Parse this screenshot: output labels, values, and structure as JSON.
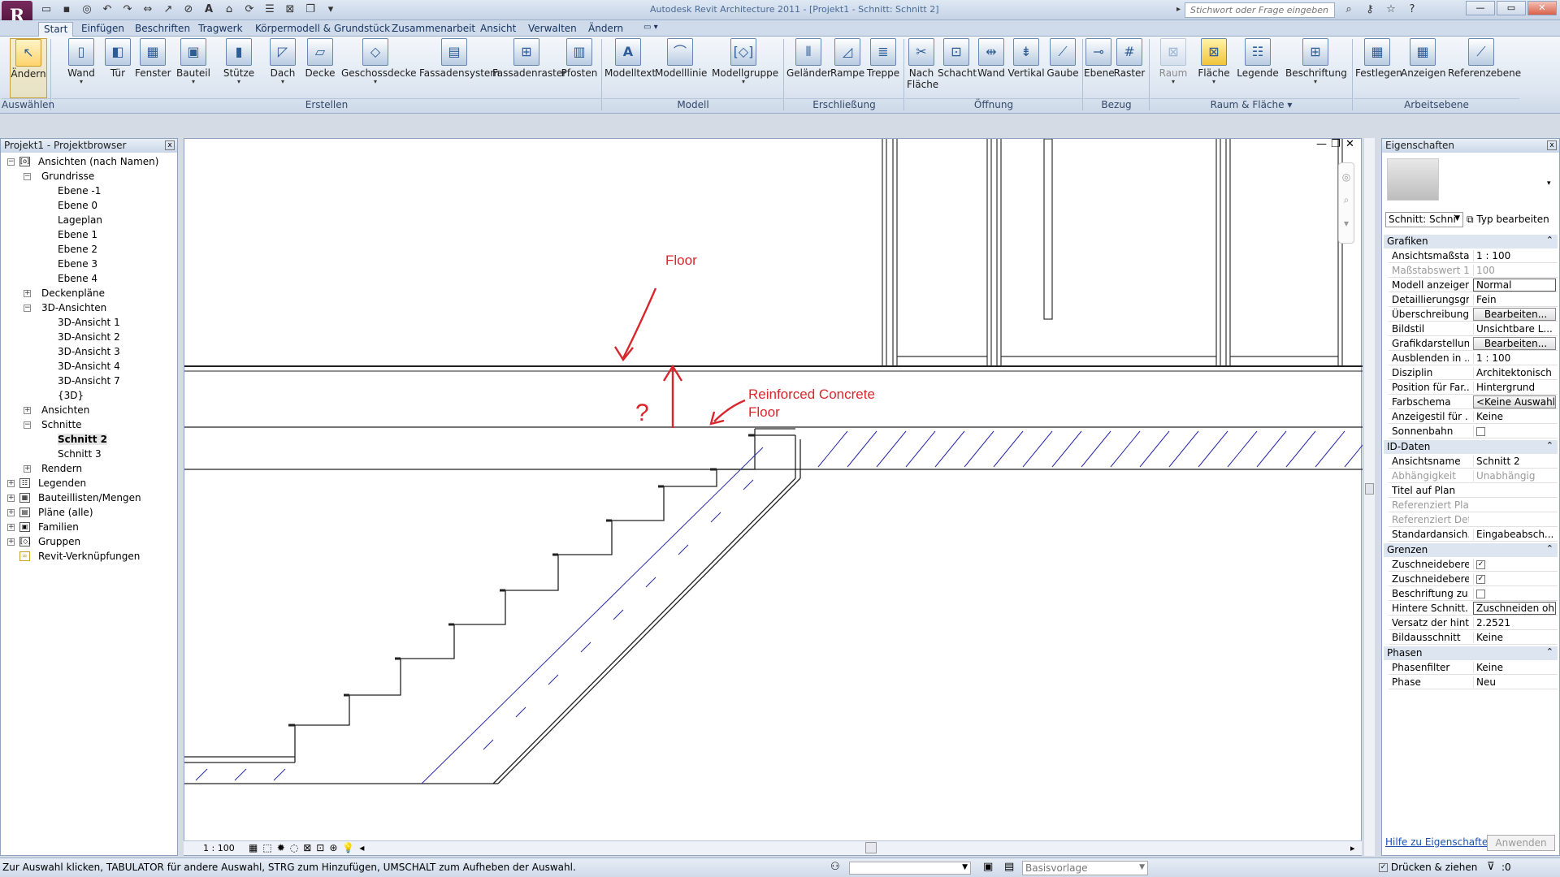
{
  "titlebar": {
    "title": "Autodesk Revit Architecture 2011 - [Projekt1 - Schnitt: Schnitt 2]",
    "search_placeholder": "Stichwort oder Frage eingeben"
  },
  "tabs": [
    "Start",
    "Einfügen",
    "Beschriften",
    "Tragwerk",
    "Körpermodell & Grundstück",
    "Zusammenarbeit",
    "Ansicht",
    "Verwalten",
    "Ändern"
  ],
  "ribbon": {
    "buttons": [
      "Ändern",
      "Wand",
      "Tür",
      "Fenster",
      "Bauteil",
      "Stütze",
      "Dach",
      "Decke",
      "Geschossdecke",
      "Fassadensystem",
      "Fassadenraster",
      "Pfosten",
      "Modelltext",
      "Modelllinie",
      "Modellgruppe",
      "Geländer",
      "Rampe",
      "Treppe",
      "Nach Fläche",
      "Schacht",
      "Wand",
      "Vertikal",
      "Gaube",
      "Ebene",
      "Raster",
      "Raum",
      "Fläche",
      "Legende",
      "Beschriftung",
      "Festlegen",
      "Anzeigen",
      "Referenzebene"
    ],
    "panels": [
      "Auswählen",
      "Erstellen",
      "Modell",
      "Erschließung",
      "Öffnung",
      "Bezug",
      "Raum & Fläche",
      "Arbeitsebene"
    ]
  },
  "browser": {
    "title": "Projekt1 - Projektbrowser",
    "items": [
      "Ansichten (nach Namen)",
      "Grundrisse",
      "Ebene -1",
      "Ebene 0",
      "Lageplan",
      "Ebene 1",
      "Ebene 2",
      "Ebene 3",
      "Ebene 4",
      "Deckenpläne",
      "3D-Ansichten",
      "3D-Ansicht 1",
      "3D-Ansicht 2",
      "3D-Ansicht 3",
      "3D-Ansicht 4",
      "3D-Ansicht 7",
      "{3D}",
      "Ansichten",
      "Schnitte",
      "Schnitt 2",
      "Schnitt 3",
      "Rendern",
      "Legenden",
      "Bauteillisten/Mengen",
      "Pläne (alle)",
      "Familien",
      "Gruppen",
      "Revit-Verknüpfungen"
    ]
  },
  "canvas": {
    "annotations": {
      "floor": "Floor",
      "question": "?",
      "rc_line1": "Reinforced Concrete",
      "rc_line2": "Floor"
    },
    "scale": "1 : 100",
    "annotation_color": "#d9262c"
  },
  "properties": {
    "title": "Eigenschaften",
    "type_selector": "Schnitt: Schni",
    "type_edit": "Typ bearbeiten",
    "groups": {
      "grafiken": "Grafiken",
      "id": "ID-Daten",
      "grenzen": "Grenzen",
      "phasen": "Phasen"
    },
    "rows": [
      {
        "k": "Ansichtsmaßstab",
        "v": "1 : 100"
      },
      {
        "k": "Maßstabswert 1:",
        "v": "100"
      },
      {
        "k": "Modell anzeigen",
        "v": "Normal"
      },
      {
        "k": "Detaillierungsgr...",
        "v": "Fein"
      },
      {
        "k": "Überschreibung...",
        "v": "Bearbeiten..."
      },
      {
        "k": "Bildstil",
        "v": "Unsichtbare L..."
      },
      {
        "k": "Grafikdarstellun...",
        "v": "Bearbeiten..."
      },
      {
        "k": "Ausblenden in ...",
        "v": "1 : 100"
      },
      {
        "k": "Disziplin",
        "v": "Architektonisch"
      },
      {
        "k": "Position für Far...",
        "v": "Hintergrund"
      },
      {
        "k": "Farbschema",
        "v": "<Keine Auswahl>"
      },
      {
        "k": "Anzeigestil für ...",
        "v": "Keine"
      },
      {
        "k": "Sonnenbahn",
        "v": ""
      },
      {
        "k": "Ansichtsname",
        "v": "Schnitt 2"
      },
      {
        "k": "Abhängigkeit",
        "v": "Unabhängig"
      },
      {
        "k": "Titel auf Plan",
        "v": ""
      },
      {
        "k": "Referenziert Plan",
        "v": ""
      },
      {
        "k": "Referenziert Det...",
        "v": ""
      },
      {
        "k": "Standardansich...",
        "v": "Eingabeabsch..."
      },
      {
        "k": "Zuschneidebere...",
        "v": ""
      },
      {
        "k": "Zuschneidebere...",
        "v": ""
      },
      {
        "k": "Beschriftung zu...",
        "v": ""
      },
      {
        "k": "Hintere Schnitt...",
        "v": "Zuschneiden ohne"
      },
      {
        "k": "Versatz der hint...",
        "v": "2.2521"
      },
      {
        "k": "Bildausschnitt",
        "v": "Keine"
      },
      {
        "k": "Phasenfilter",
        "v": "Keine"
      },
      {
        "k": "Phase",
        "v": "Neu"
      }
    ],
    "help_link": "Hilfe zu Eigenschaften",
    "apply": "Anwenden"
  },
  "status": {
    "text": "Zur Auswahl klicken, TABULATOR für andere Auswahl, STRG zum Hinzufügen, UMSCHALT zum Aufheben der Auswahl.",
    "base": "Basisvorlage",
    "drag": "Drücken & ziehen",
    "filter_count": ":0"
  }
}
